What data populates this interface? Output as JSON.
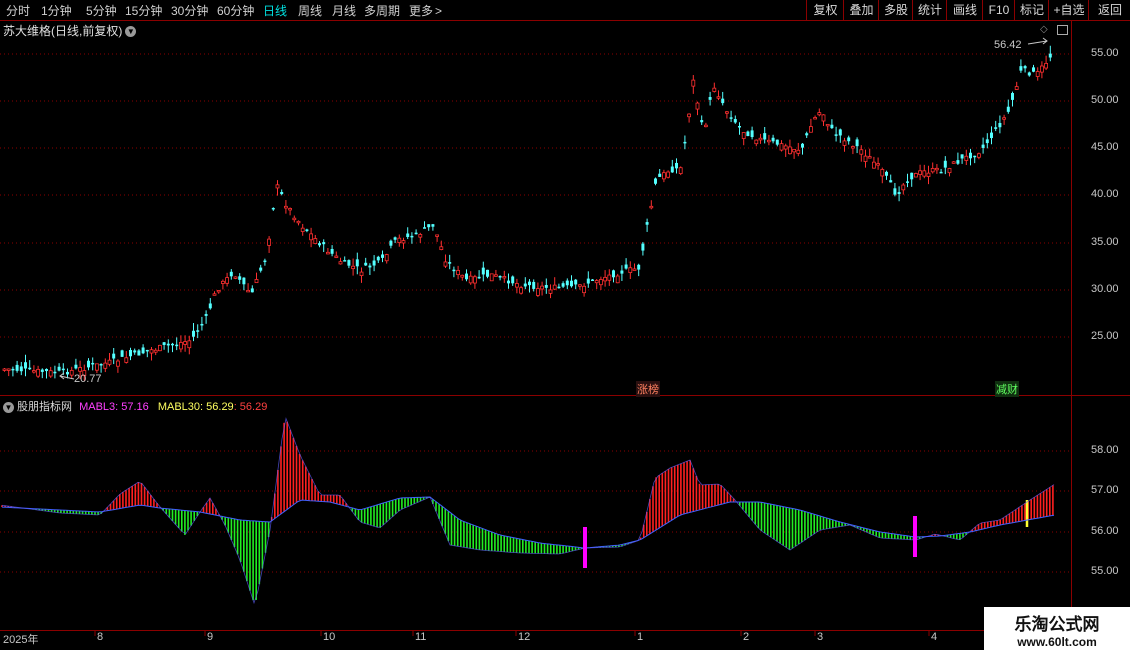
{
  "toolbar": {
    "periods": [
      "分时",
      "1分钟",
      "5分钟",
      "15分钟",
      "30分钟",
      "60分钟",
      "日线",
      "周线",
      "月线",
      "多周期",
      "更多"
    ],
    "active_period": "日线",
    "more_arrow": ">",
    "buttons": [
      "复权",
      "叠加",
      "多股",
      "统计",
      "画线",
      "F10",
      "标记",
      "+自选",
      "返回"
    ]
  },
  "main_chart": {
    "stock_title": "苏大维格(日线,前复权)",
    "max_label": "56.42",
    "min_label": "20.77",
    "y_ticks": [
      "55.00",
      "50.00",
      "45.00",
      "40.00",
      "35.00",
      "30.00",
      "25.00"
    ],
    "tags": {
      "zhangbang": "涨榜",
      "jiancai": "减财"
    }
  },
  "indicator": {
    "name": "股朋指标网",
    "mabl3_label": "MABL3: 57.16",
    "mabl30_label": "MABL30: 56.29",
    "extra_label": ": 56.29",
    "y_ticks": [
      "58.00",
      "57.00",
      "56.00",
      "55.00"
    ]
  },
  "x_axis": {
    "labels": [
      "2025年",
      "8",
      "9",
      "10",
      "11",
      "12",
      "1",
      "2",
      "3",
      "4"
    ]
  },
  "watermark": {
    "line1": "乐淘公式网",
    "line2": "www.60lt.com"
  },
  "colors": {
    "up": "#ff3030",
    "down": "#54ffff",
    "grid": "#8b0000",
    "green": "#00ff00",
    "magenta": "#ff00ff"
  }
}
